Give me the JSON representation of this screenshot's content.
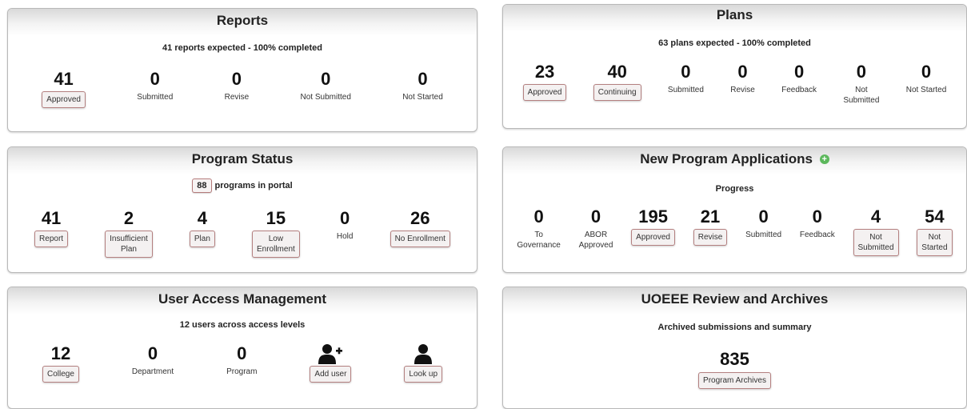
{
  "reports": {
    "title": "Reports",
    "subtitle": "41 reports expected - 100% completed",
    "stats": [
      {
        "value": "41",
        "label": "Approved",
        "button": true
      },
      {
        "value": "0",
        "label": "Submitted",
        "button": false
      },
      {
        "value": "0",
        "label": "Revise",
        "button": false
      },
      {
        "value": "0",
        "label": "Not Submitted",
        "button": false
      },
      {
        "value": "0",
        "label": "Not Started",
        "button": false
      }
    ]
  },
  "plans": {
    "title": "Plans",
    "subtitle": "63 plans expected - 100% completed",
    "stats": [
      {
        "value": "23",
        "label": "Approved",
        "button": true
      },
      {
        "value": "40",
        "label": "Continuing",
        "button": true
      },
      {
        "value": "0",
        "label": "Submitted",
        "button": false
      },
      {
        "value": "0",
        "label": "Revise",
        "button": false
      },
      {
        "value": "0",
        "label": "Feedback",
        "button": false
      },
      {
        "value": "0",
        "label": "Not\nSubmitted",
        "button": false
      },
      {
        "value": "0",
        "label": "Not Started",
        "button": false
      }
    ]
  },
  "program_status": {
    "title": "Program Status",
    "count": "88",
    "count_suffix": "programs in portal",
    "stats": [
      {
        "value": "41",
        "label": "Report",
        "button": true
      },
      {
        "value": "2",
        "label": "Insufficient\nPlan",
        "button": true
      },
      {
        "value": "4",
        "label": "Plan",
        "button": true
      },
      {
        "value": "15",
        "label": "Low\nEnrollment",
        "button": true
      },
      {
        "value": "0",
        "label": "Hold",
        "button": false
      },
      {
        "value": "26",
        "label": "No Enrollment",
        "button": true
      }
    ]
  },
  "new_program_applications": {
    "title": "New Program Applications",
    "subtitle": "Progress",
    "stats": [
      {
        "value": "0",
        "label": "To\nGovernance",
        "button": false
      },
      {
        "value": "0",
        "label": "ABOR\nApproved",
        "button": false
      },
      {
        "value": "195",
        "label": "Approved",
        "button": true
      },
      {
        "value": "21",
        "label": "Revise",
        "button": true
      },
      {
        "value": "0",
        "label": "Submitted",
        "button": false
      },
      {
        "value": "0",
        "label": "Feedback",
        "button": false
      },
      {
        "value": "4",
        "label": "Not\nSubmitted",
        "button": true
      },
      {
        "value": "54",
        "label": "Not\nStarted",
        "button": true
      }
    ]
  },
  "user_access": {
    "title": "User Access Management",
    "subtitle": "12 users across access levels",
    "stats": [
      {
        "value": "12",
        "label": "College",
        "button": true
      },
      {
        "value": "0",
        "label": "Department",
        "button": false
      },
      {
        "value": "0",
        "label": "Program",
        "button": false
      }
    ],
    "add_user_label": "Add user",
    "lookup_label": "Look up"
  },
  "uoeee": {
    "title": "UOEEE Review and Archives",
    "subtitle": "Archived submissions and summary",
    "value": "835",
    "button_label": "Program Archives"
  },
  "icons": {
    "add_user": "person-plus-icon",
    "lookup": "person-icon",
    "add_program": "plus-circle-icon"
  },
  "colors": {
    "button_border": "#b48080",
    "accent_green": "#5cb85c"
  }
}
